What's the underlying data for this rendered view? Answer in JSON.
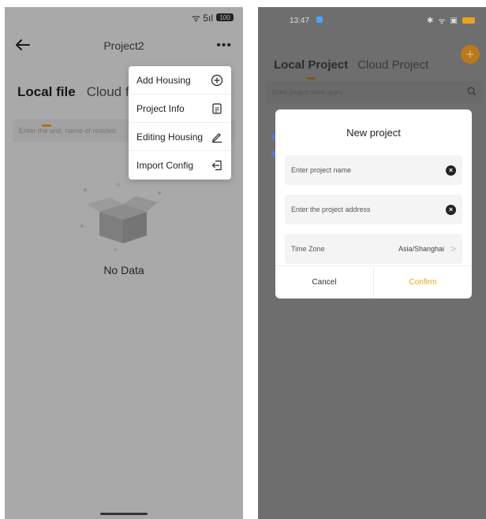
{
  "left_screen": {
    "status": {
      "signal_text": "ᯤ 5ıl",
      "battery": "100"
    },
    "appbar": {
      "back_icon": "arrow-left-icon",
      "title": "Project2",
      "more_icon": "more-horizontal-icon"
    },
    "tabs": [
      {
        "label": "Local file"
      },
      {
        "label": "Cloud fil"
      }
    ],
    "search": {
      "placeholder": "Enter the unit, name of residen"
    },
    "empty": {
      "label": "No Data",
      "icon": "empty-box-icon"
    },
    "menu": {
      "items": [
        {
          "label": "Add Housing",
          "icon": "plus-circle-icon"
        },
        {
          "label": "Project Info",
          "icon": "document-icon"
        },
        {
          "label": "Editing Housing",
          "icon": "pencil-icon"
        },
        {
          "label": "Import Config",
          "icon": "import-icon"
        }
      ]
    }
  },
  "right_screen": {
    "status": {
      "time": "13:47"
    },
    "tabs": [
      {
        "label": "Local Project"
      },
      {
        "label": "Cloud Project"
      }
    ],
    "add_icon": "plus-icon",
    "search": {
      "placeholder": "Enter project name query",
      "icon": "search-icon"
    },
    "dialog": {
      "title": "New project",
      "name_placeholder": "Enter project name",
      "address_placeholder": "Enter the project address",
      "timezone_label": "Time Zone",
      "timezone_value": "Asia/Shanghai",
      "cancel": "Cancel",
      "confirm": "Confirm"
    }
  },
  "colors": {
    "accent": "#f2a91b",
    "confirm": "#e9a31a"
  }
}
